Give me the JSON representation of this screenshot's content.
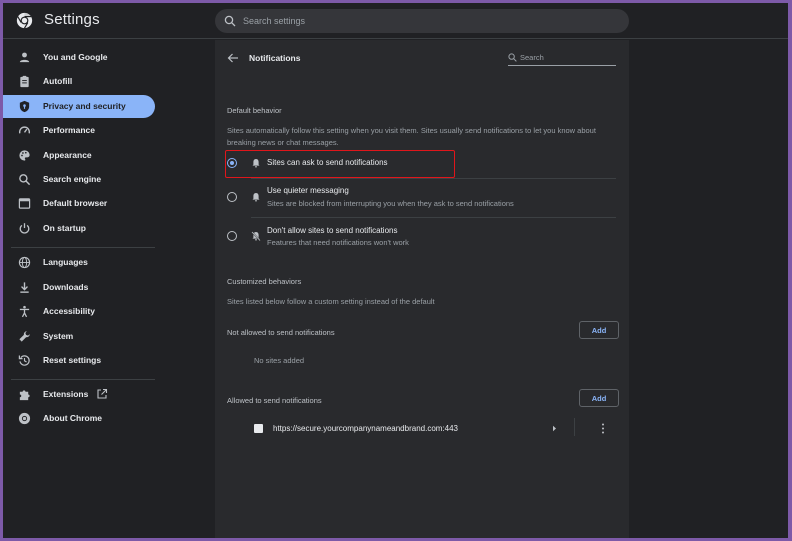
{
  "header": {
    "title": "Settings",
    "search_placeholder": "Search settings"
  },
  "sidebar": {
    "items": [
      {
        "label": "You and Google",
        "icon": "person-icon"
      },
      {
        "label": "Autofill",
        "icon": "clipboard-icon"
      },
      {
        "label": "Privacy and security",
        "icon": "shield-icon",
        "active": true
      },
      {
        "label": "Performance",
        "icon": "gauge-icon"
      },
      {
        "label": "Appearance",
        "icon": "palette-icon"
      },
      {
        "label": "Search engine",
        "icon": "search-icon"
      },
      {
        "label": "Default browser",
        "icon": "browser-icon"
      },
      {
        "label": "On startup",
        "icon": "power-icon"
      },
      {
        "label": "Languages",
        "icon": "globe-icon"
      },
      {
        "label": "Downloads",
        "icon": "download-icon"
      },
      {
        "label": "Accessibility",
        "icon": "accessibility-icon"
      },
      {
        "label": "System",
        "icon": "wrench-icon"
      },
      {
        "label": "Reset settings",
        "icon": "reset-icon"
      },
      {
        "label": "Extensions",
        "icon": "puzzle-icon"
      },
      {
        "label": "About Chrome",
        "icon": "chrome-icon"
      }
    ]
  },
  "page": {
    "title": "Notifications",
    "search_placeholder": "Search",
    "default_behavior": {
      "heading": "Default behavior",
      "description": "Sites automatically follow this setting when you visit them. Sites usually send notifications to let you know about breaking news or chat messages.",
      "options": [
        {
          "label": "Sites can ask to send notifications",
          "sub": "",
          "selected": true,
          "icon": "bell-icon"
        },
        {
          "label": "Use quieter messaging",
          "sub": "Sites are blocked from interrupting you when they ask to send notifications",
          "selected": false,
          "icon": "bell-icon"
        },
        {
          "label": "Don't allow sites to send notifications",
          "sub": "Features that need notifications won't work",
          "selected": false,
          "icon": "bell-off-icon"
        }
      ]
    },
    "customized": {
      "heading": "Customized behaviors",
      "description": "Sites listed below follow a custom setting instead of the default",
      "not_allowed_label": "Not allowed to send notifications",
      "not_allowed_add": "Add",
      "not_allowed_empty": "No sites added",
      "allowed_label": "Allowed to send notifications",
      "allowed_add": "Add",
      "allowed_sites": [
        {
          "url": "https://secure.yourcompanynameandbrand.com:443"
        }
      ]
    }
  },
  "colors": {
    "accent": "#8ab4f8",
    "highlight_box": "#e0161b",
    "frame_border": "#7d5aa8"
  }
}
